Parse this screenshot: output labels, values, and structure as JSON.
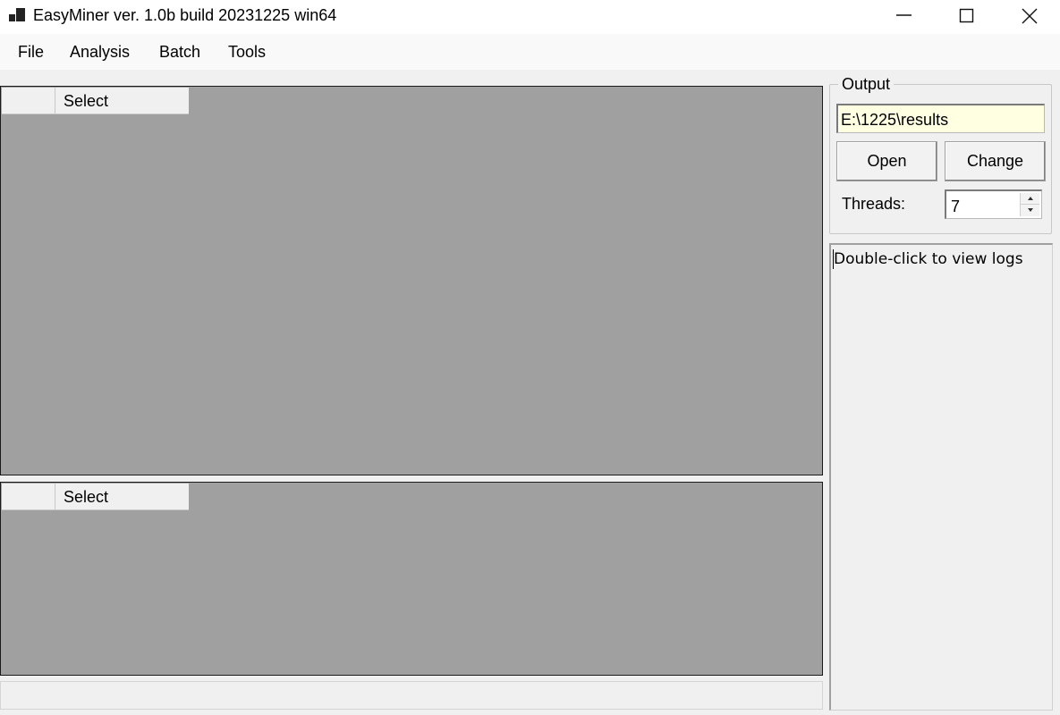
{
  "window": {
    "title": "EasyMiner ver. 1.0b build 20231225 win64",
    "icon": "app-icon"
  },
  "menu": {
    "items": [
      "File",
      "Analysis",
      "Batch",
      "Tools"
    ]
  },
  "grids": {
    "top": {
      "column_header": "Select"
    },
    "bottom": {
      "column_header": "Select"
    }
  },
  "output": {
    "group_label": "Output",
    "path_value": "E:\\1225\\results",
    "open_label": "Open",
    "change_label": "Change",
    "threads_label": "Threads:",
    "threads_value": "7"
  },
  "log": {
    "text": "Double-click to view logs"
  },
  "colors": {
    "grid_background": "#a0a0a0",
    "window_background": "#f0f0f0",
    "path_field_background": "#ffffe1"
  }
}
